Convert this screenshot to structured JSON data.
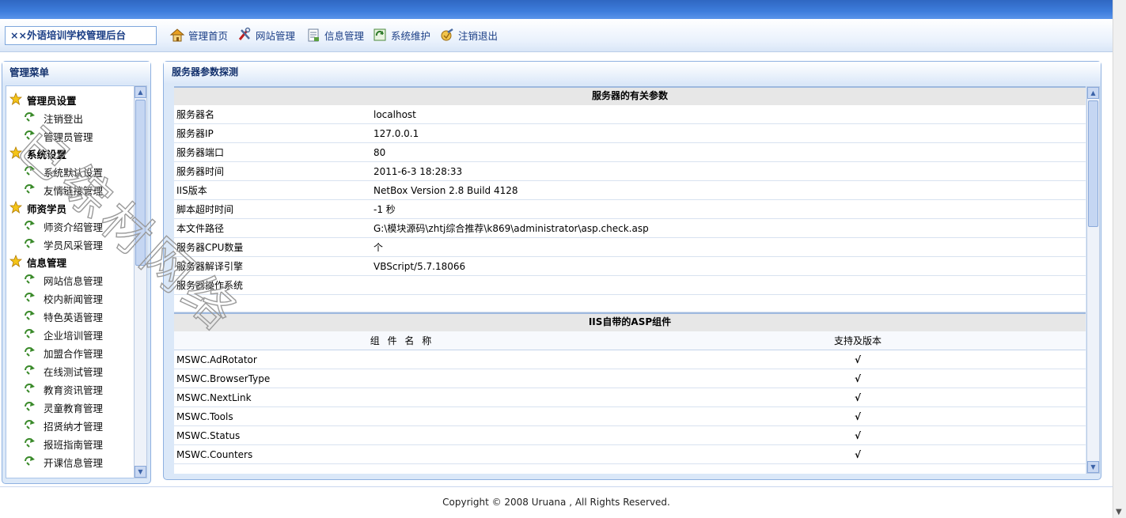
{
  "header": {
    "site_title": "××外语培训学校管理后台",
    "nav": [
      {
        "label": "管理首页",
        "icon": "home-icon"
      },
      {
        "label": "网站管理",
        "icon": "tools-icon"
      },
      {
        "label": "信息管理",
        "icon": "document-icon"
      },
      {
        "label": "系统维护",
        "icon": "refresh-icon"
      },
      {
        "label": "注销退出",
        "icon": "logout-icon"
      }
    ]
  },
  "sidebar": {
    "title": "管理菜单",
    "groups": [
      {
        "label": "管理员设置",
        "items": [
          "注销登出",
          "管理员管理"
        ]
      },
      {
        "label": "系统设置",
        "items": [
          "系统默认设置",
          "友情链接管理"
        ]
      },
      {
        "label": "师资学员",
        "items": [
          "师资介绍管理",
          "学员风采管理"
        ]
      },
      {
        "label": "信息管理",
        "items": [
          "网站信息管理",
          "校内新闻管理",
          "特色英语管理",
          "企业培训管理",
          "加盟合作管理",
          "在线测试管理",
          "教育资讯管理",
          "灵童教育管理",
          "招贤纳才管理",
          "报班指南管理",
          "开课信息管理"
        ]
      }
    ]
  },
  "main": {
    "title": "服务器参数探测",
    "server_section_title": "服务器的有关参数",
    "server_params": [
      {
        "key": "服务器名",
        "value": "localhost"
      },
      {
        "key": "服务器IP",
        "value": "127.0.0.1"
      },
      {
        "key": "服务器端口",
        "value": "80"
      },
      {
        "key": "服务器时间",
        "value": "2011-6-3 18:28:33"
      },
      {
        "key": "IIS版本",
        "value": "NetBox Version 2.8 Build 4128"
      },
      {
        "key": "脚本超时时间",
        "value": "-1 秒"
      },
      {
        "key": "本文件路径",
        "value": "G:\\模块源码\\zhtj综合推荐\\k869\\administrator\\asp.check.asp"
      },
      {
        "key": "服务器CPU数量",
        "value": "个"
      },
      {
        "key": "服务器解译引擎",
        "value": "VBScript/5.7.18066"
      },
      {
        "key": "服务器操作系统",
        "value": ""
      }
    ],
    "components_section_title": "IIS自带的ASP组件",
    "components_col_name": "组 件 名 称",
    "components_col_support": "支持及版本",
    "components": [
      {
        "name": "MSWC.AdRotator",
        "support": "√"
      },
      {
        "name": "MSWC.BrowserType",
        "support": "√"
      },
      {
        "name": "MSWC.NextLink",
        "support": "√"
      },
      {
        "name": "MSWC.Tools",
        "support": "√"
      },
      {
        "name": "MSWC.Status",
        "support": "√"
      },
      {
        "name": "MSWC.Counters",
        "support": "√"
      }
    ]
  },
  "footer": {
    "copyright": "Copyright © 2008 Uruana , All Rights Reserved."
  },
  "watermark": {
    "text": "已综材网络"
  },
  "colors": {
    "topbar": "#3e7ddc",
    "panel_bg": "#dbe8f8",
    "border": "#8fb1e0",
    "nav_text": "#1c3f86"
  }
}
